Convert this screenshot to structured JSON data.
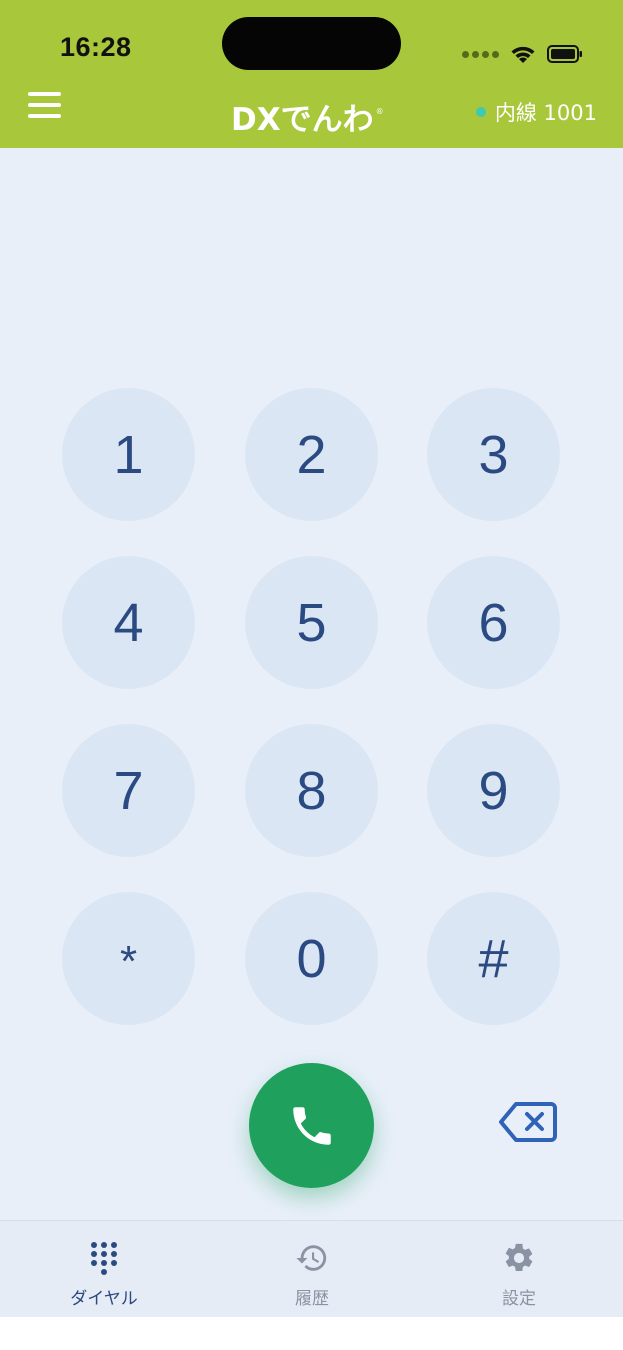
{
  "status_bar": {
    "time": "16:28"
  },
  "header": {
    "brand": "DXでんわ",
    "brand_mark": "®",
    "line_status": "内線 1001",
    "menu_icon": "hamburger-menu-icon"
  },
  "keypad": {
    "keys": [
      "1",
      "2",
      "3",
      "4",
      "5",
      "6",
      "7",
      "8",
      "9",
      "*",
      "0",
      "#"
    ]
  },
  "actions": {
    "call_icon": "phone-icon",
    "backspace_icon": "backspace-icon"
  },
  "tabbar": {
    "items": [
      {
        "label": "ダイヤル",
        "icon": "dialpad-icon",
        "active": true
      },
      {
        "label": "履歴",
        "icon": "history-icon",
        "active": false
      },
      {
        "label": "設定",
        "icon": "gear-icon",
        "active": false
      }
    ]
  },
  "colors": {
    "header_bg": "#a8c73a",
    "main_bg": "#e8eff9",
    "key_bg": "#dbe6f5",
    "key_text": "#2b4a82",
    "call_green": "#1fa15d",
    "online": "#3ec9b0",
    "tab_active": "#2b4a82",
    "tab_inactive": "#8a93a3"
  }
}
